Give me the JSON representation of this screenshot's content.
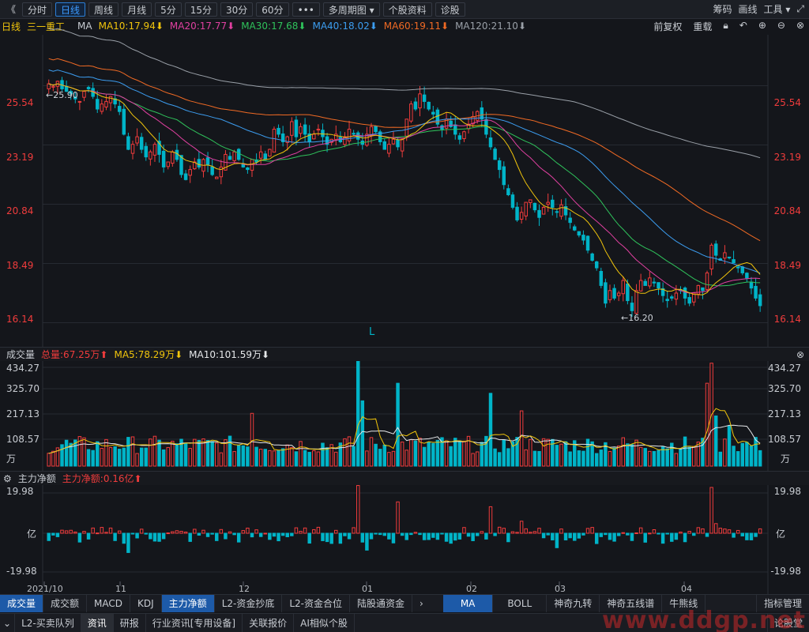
{
  "toolbar": {
    "back_glyph": "《",
    "periods": [
      "分时",
      "日线",
      "周线",
      "月线",
      "5分",
      "15分",
      "30分",
      "60分",
      "•••",
      "多周期图 ▾",
      "个股资料",
      "诊股"
    ],
    "active_period": "日线",
    "right_tools": [
      "筹码",
      "画线",
      "工具 ▾"
    ],
    "expand_glyph": "⤢"
  },
  "main_header": {
    "period": "日线",
    "stock_name": "三一重工",
    "indicator": "MA",
    "ma_values": [
      {
        "label": "MA10:17.94⬇",
        "color": "#f0c40c"
      },
      {
        "label": "MA20:17.77⬇",
        "color": "#e040a0"
      },
      {
        "label": "MA30:17.68⬇",
        "color": "#2fc25b"
      },
      {
        "label": "MA40:18.02⬇",
        "color": "#3c9df0"
      },
      {
        "label": "MA60:19.11⬇",
        "color": "#f06a24"
      },
      {
        "label": "MA120:21.10⬇",
        "color": "#9aa0a8"
      }
    ],
    "adjust": "前复权",
    "reload": "重载"
  },
  "price_axis": {
    "ticks": [
      "25.54",
      "23.19",
      "20.84",
      "18.49",
      "16.14"
    ],
    "values": [
      25.54,
      23.19,
      20.84,
      18.49,
      16.14
    ]
  },
  "annotations": {
    "high": "←25.90",
    "low": "←16.20",
    "marker": "L"
  },
  "volume": {
    "title": "成交量",
    "total": "总量:67.25万⬆",
    "ma5": "MA5:78.29万⬇",
    "ma10": "MA10:101.59万⬇",
    "ticks": [
      "434.27",
      "325.70",
      "217.13",
      "108.57",
      "万"
    ],
    "values": [
      434.27,
      325.7,
      217.13,
      108.57
    ]
  },
  "capital": {
    "title": "主力净额",
    "value": "主力净额:0.16亿⬆",
    "ticks": [
      "19.98",
      "亿",
      "-19.98"
    ],
    "values": [
      19.98,
      0,
      -19.98
    ]
  },
  "x_labels": [
    "2021/10",
    "11",
    "12",
    "01",
    "02",
    "03",
    "04"
  ],
  "tabs_left": [
    "成交量",
    "成交额",
    "MACD",
    "KDJ",
    "主力净额",
    "L2-资金抄底",
    "L2-资金合位",
    "陆股通资金"
  ],
  "tabs_left_active": [
    "成交量",
    "主力净额"
  ],
  "tabs_right": [
    "MA",
    "BOLL",
    "神奇九转",
    "神奇五线谱",
    "牛熊线"
  ],
  "tabs_right_active": "MA",
  "tabs_mgmt": "指标管理",
  "bottom_tabs": [
    "L2-买卖队列",
    "资讯",
    "研报",
    "行业资讯[专用设备]",
    "关联报价",
    "AI相似个股",
    "论股堂"
  ],
  "bottom_active": "资讯",
  "watermark": "www.ddgp.net",
  "colors": {
    "up": "#f03c3c",
    "down": "#00b4c8",
    "bg": "#14161b",
    "grid": "#262a32"
  },
  "chart_data": {
    "type": "candlestick",
    "period": "daily",
    "x_range": [
      "2021/10",
      "04"
    ],
    "price_ylim": [
      16.14,
      25.54
    ],
    "ma_last": {
      "MA10": 17.94,
      "MA20": 17.77,
      "MA30": 17.68,
      "MA40": 18.02,
      "MA60": 19.11,
      "MA120": 21.1
    },
    "period_high": 25.9,
    "period_low": 16.2,
    "closes": [
      25.6,
      25.5,
      25.7,
      25.4,
      25.3,
      25.2,
      25.0,
      24.9,
      25.3,
      25.4,
      25.1,
      24.6,
      24.8,
      24.9,
      25.1,
      24.8,
      24.5,
      23.6,
      23.0,
      23.2,
      23.5,
      23.0,
      22.7,
      22.9,
      23.2,
      22.8,
      22.3,
      22.5,
      22.9,
      22.6,
      22.0,
      21.8,
      22.2,
      22.5,
      22.3,
      22.6,
      22.4,
      22.0,
      21.9,
      22.3,
      22.8,
      22.6,
      22.9,
      22.6,
      22.3,
      22.2,
      22.6,
      22.5,
      22.9,
      22.6,
      23.0,
      23.8,
      23.6,
      23.3,
      23.5,
      24.1,
      23.5,
      23.9,
      23.6,
      23.3,
      23.6,
      23.8,
      23.5,
      23.2,
      23.4,
      23.6,
      23.3,
      23.5,
      23.8,
      23.6,
      23.4,
      23.2,
      23.6,
      23.9,
      23.7,
      23.3,
      23.0,
      23.2,
      23.4,
      23.1,
      23.4,
      24.2,
      24.8,
      24.6,
      25.2,
      24.9,
      24.6,
      24.4,
      24.0,
      23.8,
      24.2,
      23.9,
      23.6,
      23.4,
      23.7,
      24.0,
      24.3,
      24.5,
      24.2,
      23.6,
      23.1,
      22.6,
      22.2,
      21.6,
      21.2,
      20.7,
      20.2,
      20.5,
      20.9,
      21.0,
      20.6,
      20.3,
      20.7,
      20.9,
      20.7,
      20.5,
      20.8,
      20.4,
      20.1,
      19.8,
      19.6,
      19.4,
      19.0,
      18.6,
      18.3,
      17.6,
      16.9,
      17.4,
      17.1,
      17.3,
      17.8,
      17.0,
      16.6,
      17.4,
      17.8,
      17.6,
      17.9,
      17.7,
      17.5,
      17.2,
      17.0,
      17.1,
      17.3,
      17.4,
      17.1,
      16.9,
      17.3,
      17.6,
      17.4,
      18.1,
      19.2,
      18.8,
      18.6,
      18.9,
      18.7,
      18.5,
      18.3,
      18.1,
      17.9,
      17.5,
      17.1,
      16.8
    ],
    "volume_ylim": [
      0,
      434.27
    ],
    "volume_ticks": [
      108.57,
      217.13,
      325.7,
      434.27
    ],
    "volume_last": {
      "total": 67.25,
      "MA5": 78.29,
      "MA10": 101.59
    },
    "capital_ylim": [
      -19.98,
      19.98
    ],
    "capital_last": 0.16
  }
}
